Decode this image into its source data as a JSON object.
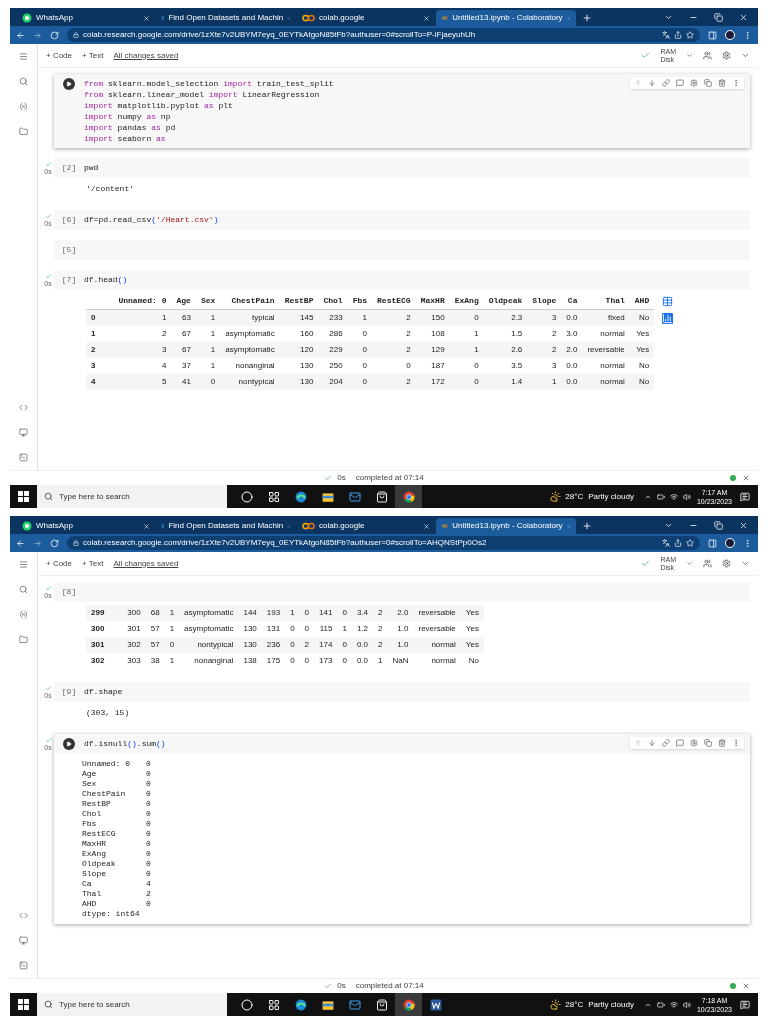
{
  "screenshots": [
    {
      "tabs": [
        {
          "kind": "whatsapp",
          "title": "WhatsApp",
          "selected": false
        },
        {
          "kind": "kaggle",
          "title": "Find Open Datasets and Machin",
          "selected": false
        },
        {
          "kind": "colab",
          "title": "colab.google",
          "selected": false
        },
        {
          "kind": "colab",
          "title": "Untitled13.ipynb - Colaboratory",
          "selected": true
        }
      ],
      "url": "colab.research.google.com/drive/1zXte7v2UBYM7eyq_0EYTkAtgoN85tFb?authuser=0#scrollTo=P-iFjaeyuhUh",
      "toolbar": {
        "add_code": "+ Code",
        "add_text": "+ Text",
        "save_status": "All changes saved",
        "ram": "RAM",
        "disk": "Disk"
      },
      "cells": [
        {
          "ran": false,
          "focused": true,
          "code": [
            [
              {
                "kind": "keyword",
                "t": "from"
              },
              {
                "kind": "plain",
                "t": " sklearn.model_selection "
              },
              {
                "kind": "keyword",
                "t": "import"
              },
              {
                "kind": "plain",
                "t": " train_test_split"
              }
            ],
            [
              {
                "kind": "keyword",
                "t": "from"
              },
              {
                "kind": "plain",
                "t": " sklearn.linear_model "
              },
              {
                "kind": "keyword",
                "t": "import"
              },
              {
                "kind": "plain",
                "t": " LinearRegression"
              }
            ],
            [
              {
                "kind": "keyword",
                "t": "import"
              },
              {
                "kind": "plain",
                "t": " matplotlib.pyplot "
              },
              {
                "kind": "keyword",
                "t": "as"
              },
              {
                "kind": "plain",
                "t": " plt"
              }
            ],
            [
              {
                "kind": "keyword",
                "t": "import"
              },
              {
                "kind": "plain",
                "t": " numpy "
              },
              {
                "kind": "keyword",
                "t": "as"
              },
              {
                "kind": "plain",
                "t": " np"
              }
            ],
            [
              {
                "kind": "keyword",
                "t": "import"
              },
              {
                "kind": "plain",
                "t": " pandas "
              },
              {
                "kind": "keyword",
                "t": "as"
              },
              {
                "kind": "plain",
                "t": " pd"
              }
            ],
            [
              {
                "kind": "keyword",
                "t": "import"
              },
              {
                "kind": "plain",
                "t": " seaborn "
              },
              {
                "kind": "keyword",
                "t": "as"
              }
            ]
          ]
        },
        {
          "prompt": "[2]",
          "ran": true,
          "duration": "0s",
          "focused": false,
          "code": [
            [
              {
                "kind": "plain",
                "t": "pwd"
              }
            ]
          ],
          "output": {
            "kind": "text",
            "lines": [
              "'/content'"
            ]
          }
        },
        {
          "prompt": "[6]",
          "ran": true,
          "duration": "0s",
          "focused": false,
          "code": [
            [
              {
                "kind": "plain",
                "t": "df=pd.read_csv"
              },
              {
                "kind": "paren",
                "t": "("
              },
              {
                "kind": "string",
                "t": "'/Heart.csv'"
              },
              {
                "kind": "paren",
                "t": ")"
              }
            ]
          ]
        },
        {
          "prompt": "[5]",
          "ran": false,
          "focused": false
        },
        {
          "prompt": "[7]",
          "ran": true,
          "duration": "0s",
          "focused": false,
          "code": [
            [
              {
                "kind": "plain",
                "t": "df.head"
              },
              {
                "kind": "paren",
                "t": "()"
              }
            ]
          ],
          "output": {
            "kind": "table",
            "columns": [
              "",
              "Unnamed: 0",
              "Age",
              "Sex",
              "ChestPain",
              "RestBP",
              "Chol",
              "Fbs",
              "RestECG",
              "MaxHR",
              "ExAng",
              "Oldpeak",
              "Slope",
              "Ca",
              "Thal",
              "AHD"
            ],
            "rows": [
              [
                "0",
                "1",
                "63",
                "1",
                "typical",
                "145",
                "233",
                "1",
                "2",
                "150",
                "0",
                "2.3",
                "3",
                "0.0",
                "fixed",
                "No"
              ],
              [
                "1",
                "2",
                "67",
                "1",
                "asymptomatic",
                "160",
                "286",
                "0",
                "2",
                "108",
                "1",
                "1.5",
                "2",
                "3.0",
                "normal",
                "Yes"
              ],
              [
                "2",
                "3",
                "67",
                "1",
                "asymptomatic",
                "120",
                "229",
                "0",
                "2",
                "129",
                "1",
                "2.6",
                "2",
                "2.0",
                "reversable",
                "Yes"
              ],
              [
                "3",
                "4",
                "37",
                "1",
                "nonanginal",
                "130",
                "250",
                "0",
                "0",
                "187",
                "0",
                "3.5",
                "3",
                "0.0",
                "normal",
                "No"
              ],
              [
                "4",
                "5",
                "41",
                "0",
                "nontypical",
                "130",
                "204",
                "0",
                "2",
                "172",
                "0",
                "1.4",
                "1",
                "0.0",
                "normal",
                "No"
              ]
            ]
          }
        }
      ],
      "status": {
        "duration": "0s",
        "text": "completed at 07:14"
      },
      "taskbar": {
        "search_placeholder": "Type here to search",
        "apps": [
          {
            "kind": "cortana",
            "active": false
          },
          {
            "kind": "taskview",
            "active": false
          },
          {
            "kind": "edge",
            "active": false
          },
          {
            "kind": "explorer",
            "active": false
          },
          {
            "kind": "mail",
            "active": false
          },
          {
            "kind": "store",
            "active": false
          },
          {
            "kind": "chrome",
            "active": true
          }
        ],
        "temperature": "28°C",
        "weather": "Partly cloudy",
        "time": "7:17 AM",
        "date": "10/23/2023"
      }
    },
    {
      "tabs": [
        {
          "kind": "whatsapp",
          "title": "WhatsApp",
          "selected": false
        },
        {
          "kind": "kaggle",
          "title": "Find Open Datasets and Machin",
          "selected": false
        },
        {
          "kind": "colab",
          "title": "colab.google",
          "selected": false
        },
        {
          "kind": "colab",
          "title": "Untitled13.ipynb - Colaboratory",
          "selected": true
        }
      ],
      "url": "colab.research.google.com/drive/1zXte7v2UBYM7eyq_0EYTkAtgoN85tFb?authuser=0#scrollTo=AHQNStPp0Os2",
      "toolbar": {
        "add_code": "+ Code",
        "add_text": "+ Text",
        "save_status": "All changes saved",
        "ram": "RAM",
        "disk": "Disk"
      },
      "cells": [
        {
          "prompt": "[8]",
          "ran": true,
          "duration": "0s",
          "focused": false,
          "output": {
            "kind": "table",
            "rows": [
              [
                "299",
                "300",
                "68",
                "1",
                "asymptomatic",
                "144",
                "193",
                "1",
                "0",
                "141",
                "0",
                "3.4",
                "2",
                "2.0",
                "reversable",
                "Yes"
              ],
              [
                "300",
                "301",
                "57",
                "1",
                "asymptomatic",
                "130",
                "131",
                "0",
                "0",
                "115",
                "1",
                "1.2",
                "2",
                "1.0",
                "reversable",
                "Yes"
              ],
              [
                "301",
                "302",
                "57",
                "0",
                "nontypical",
                "130",
                "236",
                "0",
                "2",
                "174",
                "0",
                "0.0",
                "2",
                "1.0",
                "normal",
                "Yes"
              ],
              [
                "302",
                "303",
                "38",
                "1",
                "nonanginal",
                "138",
                "175",
                "0",
                "0",
                "173",
                "0",
                "0.0",
                "1",
                "NaN",
                "normal",
                "No"
              ]
            ]
          }
        },
        {
          "prompt": "[9]",
          "ran": true,
          "duration": "0s",
          "focused": false,
          "code": [
            [
              {
                "kind": "plain",
                "t": "df.shape"
              }
            ]
          ],
          "output": {
            "kind": "text",
            "lines": [
              "(303, 15)"
            ]
          }
        },
        {
          "ran": true,
          "duration": "0s",
          "focused": true,
          "code": [
            [
              {
                "kind": "plain",
                "t": "df.isnull"
              },
              {
                "kind": "paren",
                "t": "()"
              },
              {
                "kind": "plain",
                "t": ".sum"
              },
              {
                "kind": "paren",
                "t": "()"
              }
            ]
          ],
          "output": {
            "kind": "series",
            "rows": [
              [
                "Unnamed: 0",
                "0"
              ],
              [
                "Age",
                "0"
              ],
              [
                "Sex",
                "0"
              ],
              [
                "ChestPain",
                "0"
              ],
              [
                "RestBP",
                "0"
              ],
              [
                "Chol",
                "0"
              ],
              [
                "Fbs",
                "0"
              ],
              [
                "RestECG",
                "0"
              ],
              [
                "MaxHR",
                "0"
              ],
              [
                "ExAng",
                "0"
              ],
              [
                "Oldpeak",
                "0"
              ],
              [
                "Slope",
                "0"
              ],
              [
                "Ca",
                "4"
              ],
              [
                "Thal",
                "2"
              ],
              [
                "AHD",
                "0"
              ]
            ],
            "footer": "dtype: int64"
          }
        }
      ],
      "status": {
        "duration": "0s",
        "text": "completed at 07:14"
      },
      "taskbar": {
        "search_placeholder": "Type here to search",
        "apps": [
          {
            "kind": "cortana",
            "active": false
          },
          {
            "kind": "taskview",
            "active": false
          },
          {
            "kind": "edge",
            "active": false
          },
          {
            "kind": "explorer",
            "active": false
          },
          {
            "kind": "mail",
            "active": false
          },
          {
            "kind": "store",
            "active": false
          },
          {
            "kind": "chrome",
            "active": true
          },
          {
            "kind": "word",
            "active": false
          }
        ],
        "temperature": "28°C",
        "weather": "Partly cloudy",
        "time": "7:18 AM",
        "date": "10/23/2023"
      }
    }
  ]
}
